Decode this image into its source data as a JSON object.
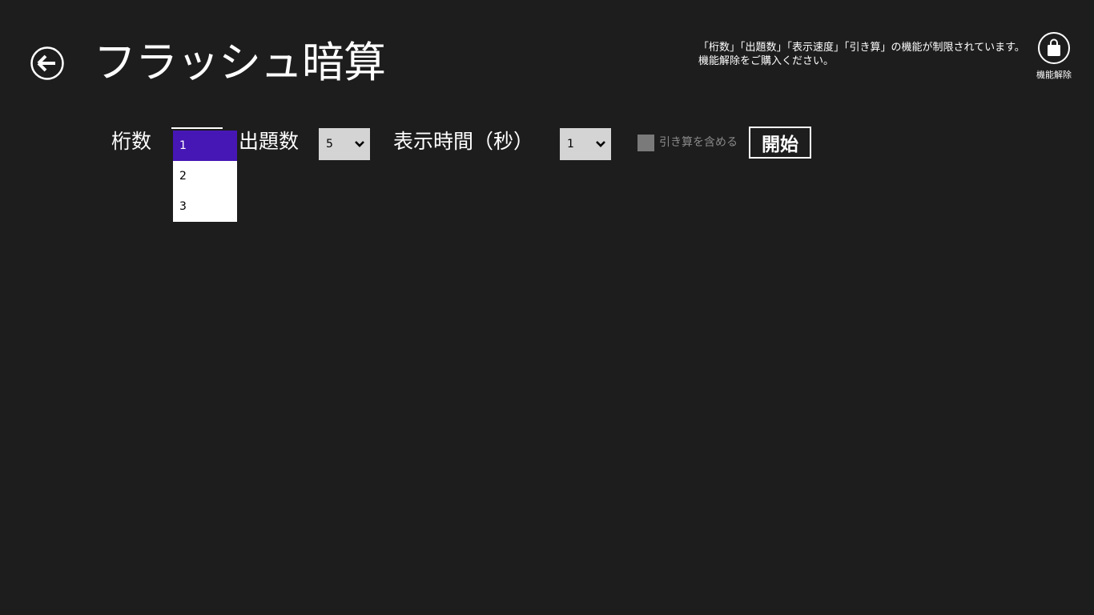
{
  "header": {
    "title": "フラッシュ暗算",
    "back_icon": "back-arrow-icon"
  },
  "notice": {
    "line1": "「桁数」「出題数」「表示速度」「引き算」の機能が制限されています。",
    "line2": "機能解除をご購入ください。"
  },
  "unlock": {
    "icon": "shopping-bag-icon",
    "label": "機能解除"
  },
  "settings": {
    "digits": {
      "label": "桁数",
      "options": [
        "1",
        "2",
        "3"
      ],
      "selected": "1"
    },
    "questions": {
      "label": "出題数",
      "value": "5"
    },
    "display_time": {
      "label": "表示時間（秒）",
      "value": "1"
    },
    "subtraction": {
      "label": "引き算を含める",
      "checked": false
    },
    "start_label": "開始"
  },
  "colors": {
    "background": "#1d1d1d",
    "accent": "#4617b4",
    "combo": "#d4d4d4"
  }
}
